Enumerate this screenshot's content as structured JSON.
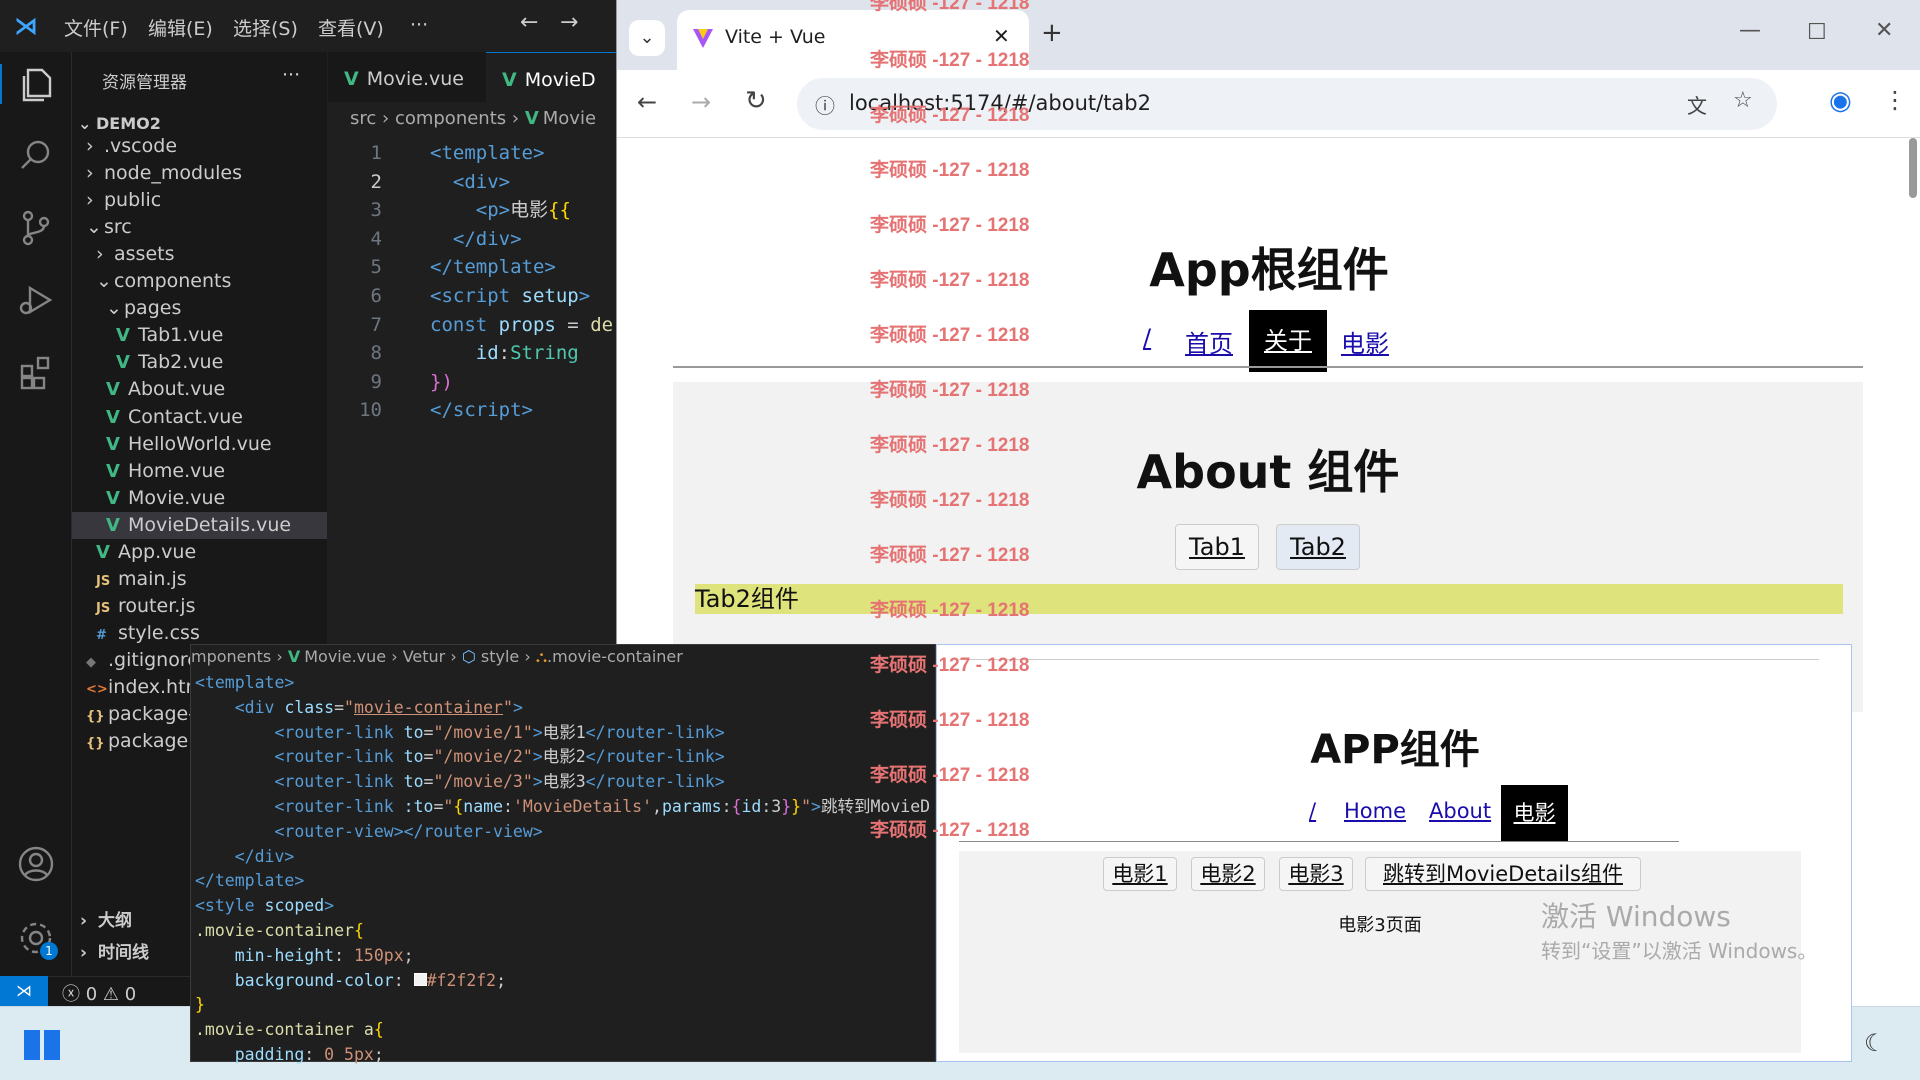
{
  "vscode": {
    "menu": [
      "文件(F)",
      "编辑(E)",
      "选择(S)",
      "查看(V)",
      "···"
    ],
    "explorer_title": "资源管理器",
    "explorer_more": "···",
    "project": "DEMO2",
    "tree": [
      {
        "label": ".vscode",
        "type": "folder",
        "indent": 1,
        "open": false
      },
      {
        "label": "node_modules",
        "type": "folder",
        "indent": 1,
        "open": false
      },
      {
        "label": "public",
        "type": "folder",
        "indent": 1,
        "open": false
      },
      {
        "label": "src",
        "type": "folder",
        "indent": 1,
        "open": true
      },
      {
        "label": "assets",
        "type": "folder",
        "indent": 2,
        "open": false
      },
      {
        "label": "components",
        "type": "folder",
        "indent": 2,
        "open": true
      },
      {
        "label": "pages",
        "type": "folder",
        "indent": 3,
        "open": true
      },
      {
        "label": "Tab1.vue",
        "type": "vue",
        "indent": 4
      },
      {
        "label": "Tab2.vue",
        "type": "vue",
        "indent": 4
      },
      {
        "label": "About.vue",
        "type": "vue",
        "indent": 3
      },
      {
        "label": "Contact.vue",
        "type": "vue",
        "indent": 3
      },
      {
        "label": "HelloWorld.vue",
        "type": "vue",
        "indent": 3
      },
      {
        "label": "Home.vue",
        "type": "vue",
        "indent": 3
      },
      {
        "label": "Movie.vue",
        "type": "vue",
        "indent": 3
      },
      {
        "label": "MovieDetails.vue",
        "type": "vue",
        "indent": 3,
        "selected": true
      },
      {
        "label": "App.vue",
        "type": "vue",
        "indent": 2
      },
      {
        "label": "main.js",
        "type": "js",
        "indent": 2
      },
      {
        "label": "router.js",
        "type": "js",
        "indent": 2
      },
      {
        "label": "style.css",
        "type": "css",
        "indent": 2
      },
      {
        "label": ".gitignore",
        "type": "git",
        "indent": 1
      },
      {
        "label": "index.html",
        "type": "html",
        "indent": 1
      },
      {
        "label": "package-lock.json",
        "type": "json",
        "indent": 1
      },
      {
        "label": "package.json",
        "type": "json",
        "indent": 1
      }
    ],
    "outline_label": "大纲",
    "timeline_label": "时间线",
    "tabs": [
      "Movie.vue",
      "MovieD"
    ],
    "breadcrumb": [
      "src",
      "components",
      "Movie"
    ],
    "code_lines": [
      "1",
      "2",
      "3",
      "4",
      "5",
      "6",
      "7",
      "8",
      "9",
      "10"
    ],
    "status_errors": "0",
    "status_warnings": "0",
    "settings_badge": "1"
  },
  "browser": {
    "tab_title": "Vite + Vue",
    "url": "localhost:5174/#/about/tab2",
    "watermark": "李硕硕 -127 - 1218",
    "app_title": "App根组件",
    "nav": [
      "/",
      "首页",
      "关于",
      "电影"
    ],
    "nav_active": "关于",
    "about_title": "About 组件",
    "about_tabs": [
      "Tab1",
      "Tab2"
    ],
    "tab2_content": "Tab2组件"
  },
  "overlay_code": {
    "breadcrumb": [
      "mponents",
      "Movie.vue",
      "Vetur",
      "style",
      ".movie-container"
    ]
  },
  "overlay_browser": {
    "title": "APP组件",
    "nav": [
      "/",
      "Home",
      "About",
      "电影"
    ],
    "nav_active": "电影",
    "movie_links": [
      "电影1",
      "电影2",
      "电影3",
      "跳转到MovieDetails组件"
    ],
    "content": "电影3页面",
    "activate_title": "激活 Windows",
    "activate_sub": "转到“设置”以激活 Windows。"
  }
}
